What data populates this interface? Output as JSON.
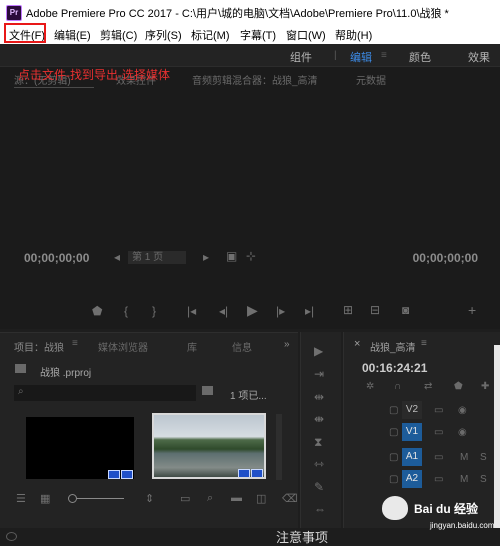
{
  "window": {
    "title": "Adobe Premiere Pro CC 2017 - C:\\用户\\城的电脑\\文档\\Adobe\\Premiere Pro\\11.0\\战狼 *",
    "logo": "Pr"
  },
  "menu": {
    "items": [
      "文件(F)",
      "编辑(E)",
      "剪辑(C)",
      "序列(S)",
      "标记(M)",
      "字幕(T)",
      "窗口(W)",
      "帮助(H)"
    ]
  },
  "workspaces": {
    "items": [
      "组件",
      "编辑",
      "颜色",
      "效果"
    ],
    "active": "编辑"
  },
  "annotation": "点击文件-找到导出-选择媒体",
  "source": {
    "tabs": [
      "源：(无剪辑)",
      "效果控件",
      "音频剪辑混合器：战狼_高清",
      "元数据"
    ],
    "timecode_left": "00;00;00;00",
    "timecode_right": "00;00;00;00",
    "fit_label": "第 1 页"
  },
  "project": {
    "tabs": [
      "项目：战狼",
      "媒体浏览器",
      "库",
      "信息"
    ],
    "file": "战狼 .prproj",
    "item_count": "1 项已...",
    "more": "»"
  },
  "timeline": {
    "title": "战狼_高清",
    "timecode": "00:16:24:21",
    "tracks": [
      "V2",
      "V1",
      "A1",
      "A2"
    ],
    "track_flags": [
      "M",
      "S"
    ]
  },
  "status": {
    "text": "注意事项"
  },
  "watermark": {
    "brand": "Bai du 经验",
    "url": "jingyan.baidu.com"
  },
  "colors": {
    "accent": "#3d8ce8",
    "highlight": "#e81818",
    "annotation": "#e83030",
    "track_blue": "#1d5c9a"
  }
}
